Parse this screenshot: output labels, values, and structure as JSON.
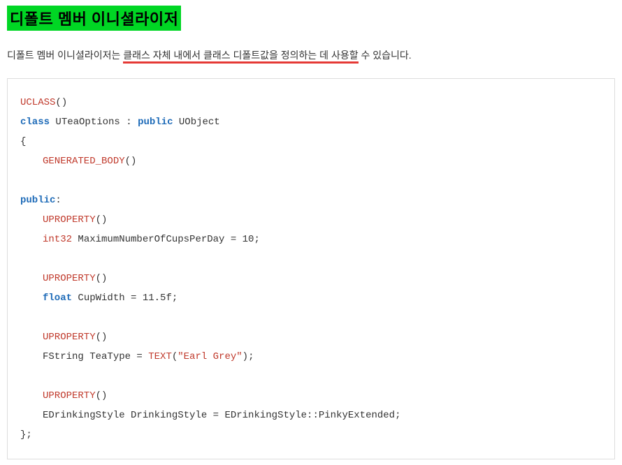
{
  "heading": "디폴트 멤버 이니셜라이저",
  "description": {
    "prefix": "디폴트 멤버 이니셜라이저는 ",
    "underlined": "클래스 자체 내에서 클래스 디폴트값을 정의하는 데 사용할",
    "suffix": " 수 있습니다."
  },
  "code": {
    "uclass": "UCLASS",
    "paren": "()",
    "class_kw": "class",
    "class_name": "UTeaOptions",
    "colon_public": " : ",
    "public_kw": "public",
    "base": " UObject",
    "open_brace": "{",
    "gen_body": "GENERATED_BODY",
    "public_label": "public",
    "public_colon": ":",
    "uproperty": "UPROPERTY",
    "int32": "int32",
    "line1_rest": " MaximumNumberOfCupsPerDay = 10;",
    "float_kw": "float",
    "line2_rest": " CupWidth = 11.5f;",
    "fstring": "FString TeaType = ",
    "text_macro": "TEXT",
    "text_open": "(",
    "text_str": "\"Earl Grey\"",
    "text_close": ");",
    "line4": "EDrinkingStyle DrinkingStyle = EDrinkingStyle::PinkyExtended;",
    "close_brace": "};"
  }
}
